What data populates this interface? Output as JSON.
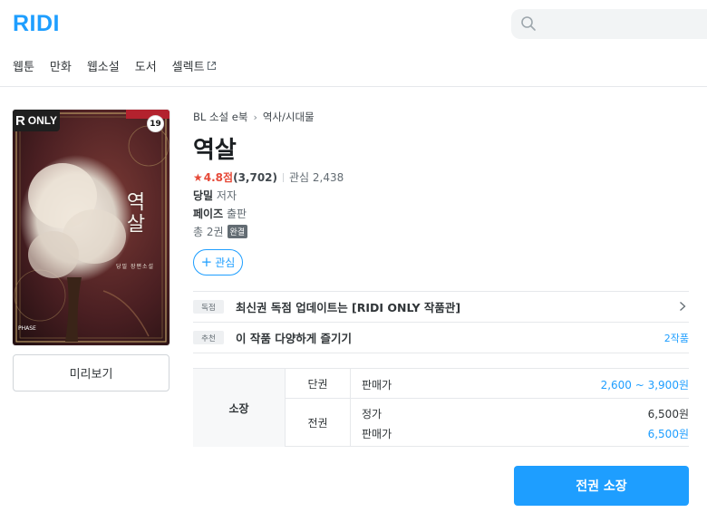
{
  "header": {
    "logo": "RIDI",
    "search_placeholder": "",
    "nav": [
      "웹툰",
      "만화",
      "웹소설",
      "도서",
      "셀렉트"
    ]
  },
  "cover": {
    "badge_only_r": "R",
    "badge_only_text": "ONLY",
    "badge_age": "19",
    "title_art": "역살",
    "subtitle_art": "당밀 장편소설",
    "publisher_art": "PHASE"
  },
  "preview_label": "미리보기",
  "book": {
    "breadcrumb": [
      "BL 소설 e북",
      "역사/시대물"
    ],
    "title": "역살",
    "rating_score": "4.8점",
    "rating_count": "(3,702)",
    "favorite_count": "관심 2,438",
    "author_name": "당밀",
    "author_role": "저자",
    "publisher_name": "페이즈",
    "publisher_role": "출판",
    "volumes": "총 2권",
    "completed_tag": "완결",
    "favorite_button": "관심"
  },
  "notices": [
    {
      "tag": "독점",
      "text": "최신권 독점 업데이트는 [RIDI ONLY 작품관]",
      "right": ""
    },
    {
      "tag": "추천",
      "text": "이 작품 다양하게 즐기기",
      "right": "2작품"
    }
  ],
  "price_table": {
    "own_label": "소장",
    "single_type": "단권",
    "single_label": "판매가",
    "single_value": "2,600 ~ 3,900원",
    "full_type": "전권",
    "full_list_label": "정가",
    "full_list_value": "6,500원",
    "full_sale_label": "판매가",
    "full_sale_value": "6,500원"
  },
  "buy_button": "전권 소장",
  "colors": {
    "brand": "#1e9eff",
    "star": "#e64938"
  }
}
